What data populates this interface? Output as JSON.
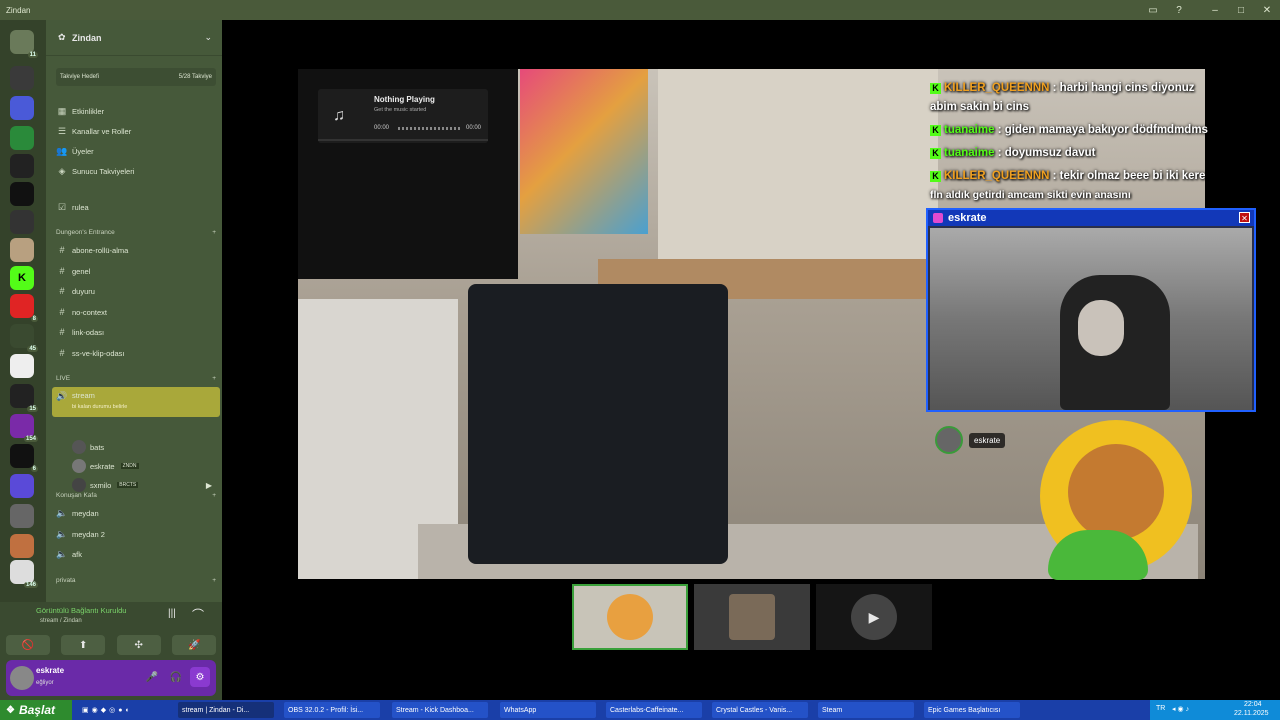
{
  "window": {
    "title": "Zindan",
    "controls": [
      "▭",
      "?",
      "–",
      "□",
      "✕"
    ]
  },
  "rail": {
    "badges": [
      "11",
      "8",
      "45",
      "15",
      "154",
      "6",
      "146"
    ]
  },
  "server": {
    "name": "Zindan",
    "boost": {
      "label": "Takviye Hedefi",
      "progress": "5/28 Takviye"
    },
    "menu": [
      "Etkinlikler",
      "Kanallar ve Roller",
      "Üyeler",
      "Sunucu Takviyeleri",
      "rulea"
    ],
    "categories": {
      "dungeons": "Dungeon's Entrance",
      "live": "LIVE",
      "konusan": "Konuşan Kafa",
      "privata": "privata"
    },
    "text_channels": [
      "abone-rollü-alma",
      "genel",
      "duyuru",
      "no-context",
      "link-odası",
      "ss-ve-klip-odası"
    ],
    "stream_channel": {
      "name": "stream",
      "sub": "bi kalan durumu belirle"
    },
    "stream_users": [
      {
        "name": "bats",
        "tag": ""
      },
      {
        "name": "eskrate",
        "tag": "ZNDN"
      },
      {
        "name": "sxmilo",
        "tag": "BRCTS"
      }
    ],
    "voice_channels": [
      "meydan",
      "meydan 2",
      "afk"
    ]
  },
  "voice_status": {
    "title": "Görüntülü Bağlantı Kuruldu",
    "sub": "stream / Zindan"
  },
  "action_icons": [
    "🚫",
    "⬆",
    "✣",
    "🚀"
  ],
  "user": {
    "name": "eskrate",
    "status": "eğliyor",
    "mic": "🎤",
    "headset": "🎧",
    "settings": "⚙"
  },
  "music": {
    "title": "Nothing Playing",
    "subtitle": "Get the music started",
    "time_start": "00:00",
    "time_end": "00:00",
    "icon": "♫"
  },
  "chat": [
    {
      "user": "KILLER_QUEENNN",
      "color": "#f0a020",
      "text": "harbi hangi cins diyonuz"
    },
    {
      "user": "",
      "color": "#fff",
      "text": "abim sakin bi cins"
    },
    {
      "user": "tuanaime",
      "color": "#53fc18",
      "text": "giden mamaya bakıyor dödfmdmdms"
    },
    {
      "user": "tuanaime",
      "color": "#53fc18",
      "text": "doyumsuz davut"
    },
    {
      "user": "KILLER_QUEENNN",
      "color": "#f0a020",
      "text": "tekir olmaz beee bi iki kere"
    },
    {
      "user": "",
      "color": "#fff",
      "text": "fln aldık getirdi amcam sikti evin anasını"
    }
  ],
  "webcam": {
    "name": "eskrate",
    "close": "✕"
  },
  "speaker": {
    "name": "eskrate"
  },
  "taskbar": {
    "start": "Başlat",
    "items": [
      "stream | Zindan - Di...",
      "OBS 32.0.2 - Profil: İsi...",
      "Stream - Kick Dashboa...",
      "WhatsApp",
      "Casterlabs-Caffeinate...",
      "Crystal Castles - Vanis...",
      "Steam",
      "Epic Games Başlatıcısı"
    ],
    "lang": "TR",
    "time": "22:04",
    "date": "22.11.2025"
  },
  "colors": {
    "accent_green": "#53fc18",
    "killer": "#f0a020",
    "cam_blue": "#1238b8"
  }
}
